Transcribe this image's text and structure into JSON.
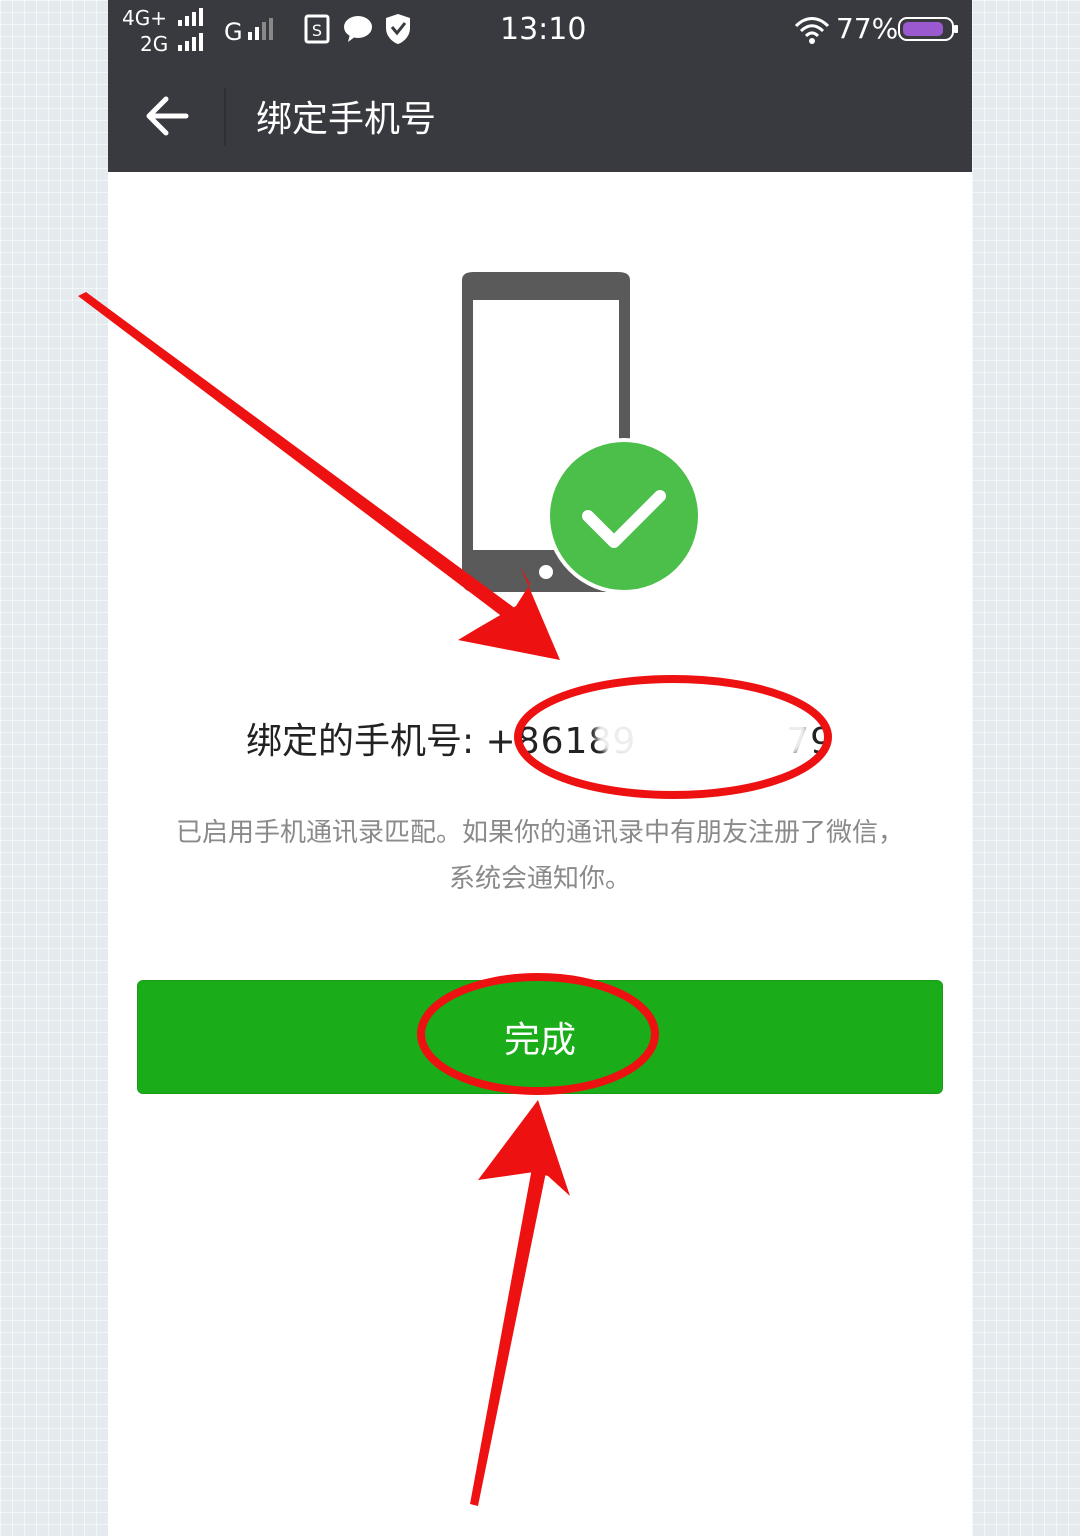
{
  "status_bar": {
    "network_top": "4G+",
    "network_bottom": "2G",
    "network_g": "G",
    "time": "13:10",
    "battery": "77%",
    "icons": [
      "signal-icon",
      "sim-s-icon",
      "chat-bubble-icon",
      "vpn-shield-icon",
      "wifi-icon",
      "battery-icon"
    ]
  },
  "title_bar": {
    "back_icon": "arrow-left-icon",
    "title": "绑定手机号"
  },
  "illustration": {
    "icons": [
      "smartphone-icon",
      "checkmark-circle-icon"
    ],
    "check_color": "#4cbf4a",
    "phone_color": "#5a5a5a"
  },
  "binding": {
    "label": "绑定的手机号: ",
    "number_prefix": "+86189",
    "number_suffix": "79"
  },
  "description": {
    "line1": "已启用手机通讯录匹配。如果你的通讯录中有朋友注册了微信，",
    "line2": "系统会通知你。"
  },
  "done_button": {
    "label": "完成",
    "color": "#1aad19"
  },
  "annotations": {
    "color": "#ee1111",
    "marks": [
      "red-arrow",
      "red-circle"
    ]
  }
}
